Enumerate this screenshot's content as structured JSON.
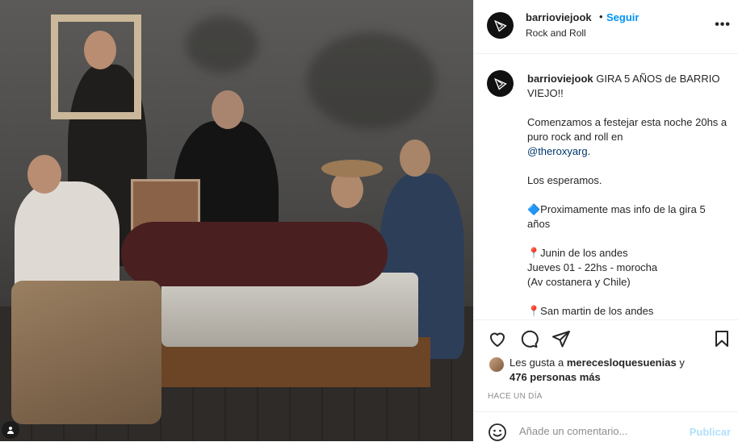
{
  "header": {
    "username": "barrioviejook",
    "separator": "•",
    "follow_label": "Seguir",
    "location": "Rock and Roll",
    "more_icon": "more-horizontal-icon"
  },
  "caption": {
    "username": "barrioviejook",
    "title": "GIRA 5 AÑOS de BARRIO VIEJO!!",
    "p1_text": "Comenzamos a festejar esta noche 20hs a puro rock and roll en",
    "p1_mention": "@theroxyarg",
    "p1_end": ".",
    "p2": "Los esperamos.",
    "p3": "🔷Proximamente mas info de la gira 5 años",
    "p4": "📍Junin de los andes\nJueves 01 - 22hs - morocha\n(Av costanera y Chile)",
    "p5": "📍San martin de los andes"
  },
  "actions": {
    "like_icon": "heart-icon",
    "comment_icon": "comment-icon",
    "share_icon": "paper-plane-icon",
    "save_icon": "bookmark-icon"
  },
  "likes": {
    "prefix": "Les gusta a",
    "user": "merecesloquesuenias",
    "connector": "y",
    "others": "476 personas más"
  },
  "timestamp": "HACE UN DÍA",
  "comment": {
    "placeholder": "Añade un comentario...",
    "publish_label": "Publicar"
  },
  "colors": {
    "accent": "#0095f6",
    "publish_disabled": "#b2dffc",
    "mention": "#00376b",
    "muted": "#8e8e8e"
  }
}
